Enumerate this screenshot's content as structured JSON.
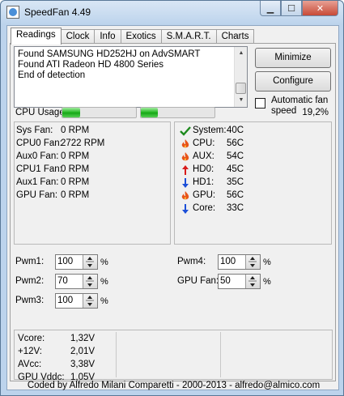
{
  "window": {
    "title": "SpeedFan 4.49"
  },
  "tabs": [
    {
      "label": "Readings",
      "active": true
    },
    {
      "label": "Clock"
    },
    {
      "label": "Info"
    },
    {
      "label": "Exotics"
    },
    {
      "label": "S.M.A.R.T."
    },
    {
      "label": "Charts"
    }
  ],
  "log": {
    "lines": [
      "Found SAMSUNG HD252HJ on AdvSMART",
      "Found ATI Radeon HD 4800 Series",
      "End of detection"
    ]
  },
  "buttons": {
    "minimize": "Minimize",
    "configure": "Configure"
  },
  "auto_fan": {
    "label_line1": "Automatic fan",
    "label_line2": "speed",
    "checked": false
  },
  "cpu_usage": {
    "label": "CPU Usage",
    "percent_text": "19,2%",
    "bar1_fraction": 0.24,
    "bar2_fraction": 0.23
  },
  "fans": [
    {
      "name": "Sys Fan:",
      "value": "0 RPM"
    },
    {
      "name": "CPU0 Fan:",
      "value": "2722 RPM"
    },
    {
      "name": "Aux0 Fan:",
      "value": "0 RPM"
    },
    {
      "name": "CPU1 Fan:",
      "value": "0 RPM"
    },
    {
      "name": "Aux1 Fan:",
      "value": "0 RPM"
    },
    {
      "name": "GPU Fan:",
      "value": "0 RPM"
    }
  ],
  "temps": [
    {
      "name": "System:",
      "value": "40C",
      "icon": "check-icon"
    },
    {
      "name": "CPU:",
      "value": "56C",
      "icon": "flame-icon"
    },
    {
      "name": "AUX:",
      "value": "54C",
      "icon": "flame-icon"
    },
    {
      "name": "HD0:",
      "value": "45C",
      "icon": "arrow-up-icon"
    },
    {
      "name": "HD1:",
      "value": "35C",
      "icon": "arrow-down-icon"
    },
    {
      "name": "GPU:",
      "value": "56C",
      "icon": "flame-icon"
    },
    {
      "name": "Core:",
      "value": "33C",
      "icon": "arrow-down-icon"
    }
  ],
  "pwm": {
    "pwm1": {
      "label": "Pwm1:",
      "value": "100",
      "unit": "%"
    },
    "pwm2": {
      "label": "Pwm2:",
      "value": "70",
      "unit": "%"
    },
    "pwm3": {
      "label": "Pwm3:",
      "value": "100",
      "unit": "%"
    },
    "pwm4": {
      "label": "Pwm4:",
      "value": "100",
      "unit": "%"
    },
    "gpu_fan": {
      "label": "GPU Fan:",
      "value": "50",
      "unit": "%"
    }
  },
  "voltages": [
    {
      "name": "Vcore:",
      "value": "1,32V"
    },
    {
      "name": "+12V:",
      "value": "2,01V"
    },
    {
      "name": "AVcc:",
      "value": "3,38V"
    },
    {
      "name": "GPU Vddc:",
      "value": "1,05V"
    }
  ],
  "footer": "Coded by Alfredo Milani Comparetti - 2000-2013 - alfredo@almico.com",
  "colors": {
    "flame": "#e8541a",
    "check": "#1d8a1d",
    "arrow_up": "#d81b1b",
    "arrow_down": "#1c4fd8",
    "bar_green": "#1fb51d"
  }
}
